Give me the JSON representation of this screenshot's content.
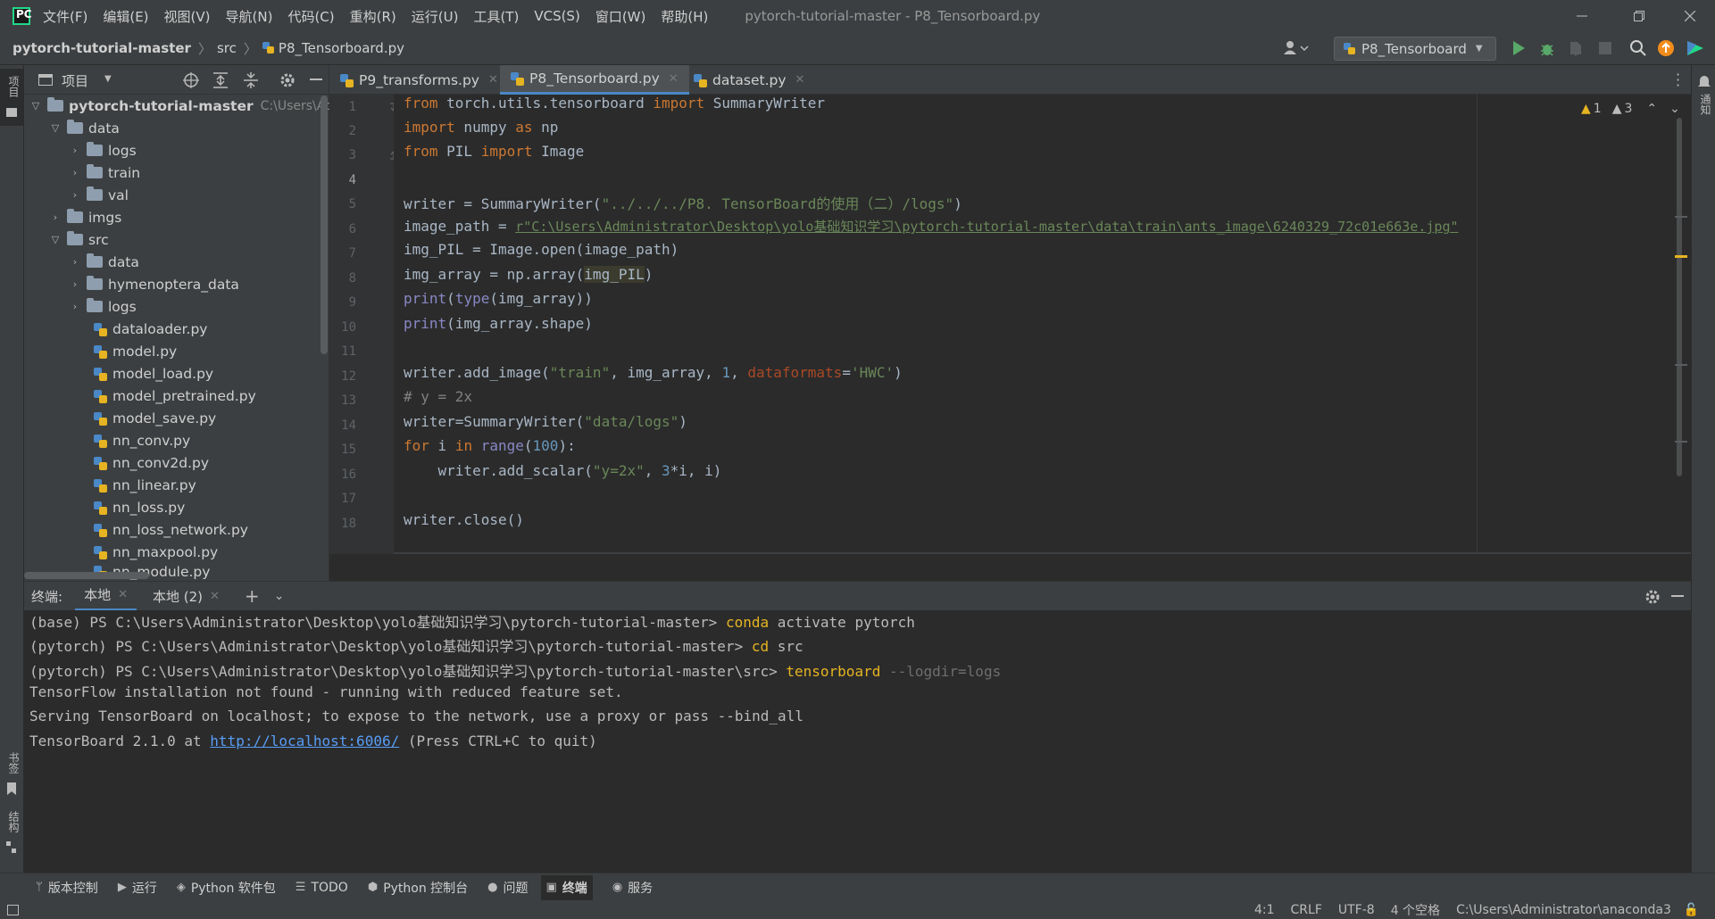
{
  "titlebar": {
    "menus": [
      "文件(F)",
      "编辑(E)",
      "视图(V)",
      "导航(N)",
      "代码(C)",
      "重构(R)",
      "运行(U)",
      "工具(T)",
      "VCS(S)",
      "窗口(W)",
      "帮助(H)"
    ],
    "window_title": "pytorch-tutorial-master - P8_Tensorboard.py"
  },
  "navbar": {
    "crumbs": [
      "pytorch-tutorial-master",
      "src",
      "P8_Tensorboard.py"
    ],
    "run_config": "P8_Tensorboard"
  },
  "project": {
    "header_label": "项目",
    "strip_label": "项目",
    "tree": [
      {
        "label": "pytorch-tutorial-master",
        "hint": "C:\\Users\\Adm",
        "bold": true
      },
      {
        "label": "data"
      },
      {
        "label": "logs"
      },
      {
        "label": "train"
      },
      {
        "label": "val"
      },
      {
        "label": "imgs"
      },
      {
        "label": "src"
      },
      {
        "label": "data"
      },
      {
        "label": "hymenoptera_data"
      },
      {
        "label": "logs"
      },
      {
        "label": "dataloader.py"
      },
      {
        "label": "model.py"
      },
      {
        "label": "model_load.py"
      },
      {
        "label": "model_pretrained.py"
      },
      {
        "label": "model_save.py"
      },
      {
        "label": "nn_conv.py"
      },
      {
        "label": "nn_conv2d.py"
      },
      {
        "label": "nn_linear.py"
      },
      {
        "label": "nn_loss.py"
      },
      {
        "label": "nn_loss_network.py"
      },
      {
        "label": "nn_maxpool.py"
      },
      {
        "label": "nn_module.py"
      }
    ]
  },
  "editor": {
    "tabs": [
      "P9_transforms.py",
      "P8_Tensorboard.py",
      "dataset.py"
    ],
    "warnings_a": "1",
    "warnings_b": "3",
    "line_numbers": [
      "1",
      "2",
      "3",
      "4",
      "5",
      "6",
      "7",
      "8",
      "9",
      "10",
      "11",
      "12",
      "13",
      "14",
      "15",
      "16",
      "17",
      "18"
    ],
    "code": {
      "l1_a": "from",
      "l1_b": " torch.utils.tensorboard ",
      "l1_c": "import",
      "l1_d": " SummaryWriter",
      "l2_a": "import",
      "l2_b": " numpy ",
      "l2_c": "as",
      "l2_d": " np",
      "l3_a": "from",
      "l3_b": " PIL ",
      "l3_c": "import",
      "l3_d": " Image",
      "l5_a": "writer = SummaryWriter(",
      "l5_b": "\"../../../P8. TensorBoard的使用（二）/logs\"",
      "l5_c": ")",
      "l6_a": "image_path = ",
      "l6_b": "r\"C:\\Users\\Administrator\\Desktop\\yolo基础知识学习\\pytorch-tutorial-master\\data\\train\\ants_image\\6240329_72c01e663e.jpg\"",
      "l7": "img_PIL = Image.open(image_path)",
      "l8_a": "img_array = np.array(",
      "l8_b": "img_PIL",
      "l8_c": ")",
      "l9_a": "print",
      "l9_b": "(",
      "l9_c": "type",
      "l9_d": "(img_array))",
      "l10_a": "print",
      "l10_b": "(img_array.shape)",
      "l12_a": "writer.add_image(",
      "l12_b": "\"train\"",
      "l12_c": ", img_array, ",
      "l12_d": "1",
      "l12_e": ", ",
      "l12_f": "dataformats",
      "l12_g": "=",
      "l12_h": "'HWC'",
      "l12_i": ")",
      "l13": "# y = 2x",
      "l14_a": "writer=SummaryWriter(",
      "l14_b": "\"data/logs\"",
      "l14_c": ")",
      "l15_a": "for",
      "l15_b": " i ",
      "l15_c": "in",
      "l15_d": " ",
      "l15_e": "range",
      "l15_f": "(",
      "l15_g": "100",
      "l15_h": "):",
      "l16_a": "    writer.add_scalar(",
      "l16_b": "\"y=2x\"",
      "l16_c": ", ",
      "l16_d": "3",
      "l16_e": "*i, i)",
      "l18": "writer.close()"
    }
  },
  "terminal": {
    "label": "终端:",
    "tabs": [
      "本地",
      "本地 (2)"
    ],
    "lines": {
      "t1_a": "(base) PS C:\\Users\\Administrator\\Desktop\\yolo基础知识学习\\pytorch-tutorial-master> ",
      "t1_b": "conda",
      "t1_c": " activate pytorch",
      "t2_a": "(pytorch) PS C:\\Users\\Administrator\\Desktop\\yolo基础知识学习\\pytorch-tutorial-master> ",
      "t2_b": "cd",
      "t2_c": " src",
      "t3_a": "(pytorch) PS C:\\Users\\Administrator\\Desktop\\yolo基础知识学习\\pytorch-tutorial-master\\src> ",
      "t3_b": "tensorboard",
      "t3_c": " --logdir=logs",
      "t4": "TensorFlow installation not found - running with reduced feature set.",
      "t5": "Serving TensorBoard on localhost; to expose to the network, use a proxy or pass --bind_all",
      "t6_a": "TensorBoard 2.1.0 at ",
      "t6_b": "http://localhost:6006/",
      "t6_c": " (Press CTRL+C to quit)"
    }
  },
  "left_labels": {
    "bookmarks": "书签",
    "structure": "结构"
  },
  "right_labels": {
    "notifications": "通知"
  },
  "toolwindows": [
    "版本控制",
    "运行",
    "Python 软件包",
    "TODO",
    "Python 控制台",
    "问题",
    "终端",
    "服务"
  ],
  "statusbar": {
    "position": "4:1",
    "line_sep": "CRLF",
    "encoding": "UTF-8",
    "indent": "4 个空格",
    "interpreter": "C:\\Users\\Administrator\\anaconda3"
  },
  "colors": {
    "accent": "#4a88c7",
    "run": "#59a869",
    "warning": "#e6b422"
  }
}
